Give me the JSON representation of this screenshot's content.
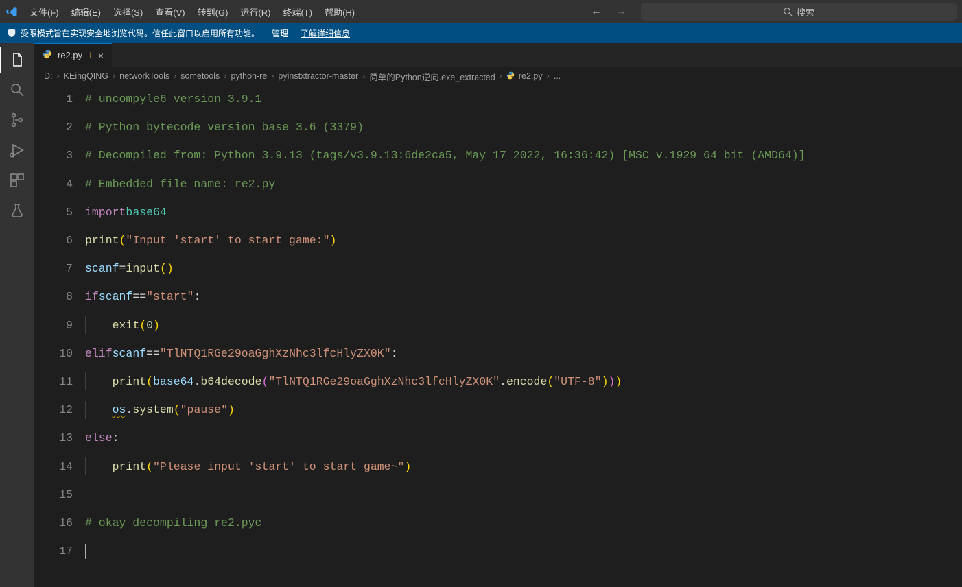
{
  "menu": {
    "items": [
      "文件(F)",
      "编辑(E)",
      "选择(S)",
      "查看(V)",
      "转到(G)",
      "运行(R)",
      "终端(T)",
      "帮助(H)"
    ]
  },
  "search": {
    "placeholder": "搜索"
  },
  "infobar": {
    "text": "受限模式旨在实现安全地浏览代码。信任此窗口以启用所有功能。",
    "manage": "管理",
    "learn": "了解详细信息"
  },
  "tab": {
    "filename": "re2.py",
    "problems": "1"
  },
  "breadcrumbs": [
    "D:",
    "KEingQING",
    "networkTools",
    "sometools",
    "python-re",
    "pyinstxtractor-master",
    "简单的Python逆向.exe_extracted",
    "re2.py",
    "..."
  ],
  "code": {
    "lines": [
      {
        "n": 1,
        "kind": "comment",
        "text": "# uncompyle6 version 3.9.1"
      },
      {
        "n": 2,
        "kind": "comment",
        "text": "# Python bytecode version base 3.6 (3379)"
      },
      {
        "n": 3,
        "kind": "comment",
        "text": "# Decompiled from: Python 3.9.13 (tags/v3.9.13:6de2ca5, May 17 2022, 16:36:42) [MSC v.1929 64 bit (AMD64)]"
      },
      {
        "n": 4,
        "kind": "comment",
        "text": "# Embedded file name: re2.py"
      },
      {
        "n": 5,
        "kind": "import",
        "kw": "import",
        "mod": "base64"
      },
      {
        "n": 6,
        "kind": "call",
        "indent": 0,
        "func": "print",
        "args_str": "\"Input 'start' to start game:\""
      },
      {
        "n": 7,
        "kind": "assign",
        "var": "scanf",
        "op": "=",
        "func": "input",
        "args_str": ""
      },
      {
        "n": 8,
        "kind": "if",
        "kw": "if",
        "cond_var": "scanf",
        "op": "==",
        "cond_str": "\"start\""
      },
      {
        "n": 9,
        "kind": "call",
        "indent": 1,
        "func": "exit",
        "args_num": "0"
      },
      {
        "n": 10,
        "kind": "elif",
        "kw": "elif",
        "cond_var": "scanf",
        "op": "==",
        "cond_str": "\"TlNTQ1RGe29oaGghXzNhc3lfcHlyZX0K\""
      },
      {
        "n": 11,
        "kind": "call2",
        "indent": 1,
        "func": "print",
        "obj": "base64",
        "method": "b64decode",
        "inner_str": "\"TlNTQ1RGe29oaGghXzNhc3lfcHlyZX0K\"",
        "chain_method": "encode",
        "chain_arg": "\"UTF-8\""
      },
      {
        "n": 12,
        "kind": "call3",
        "indent": 1,
        "obj": "os",
        "method": "system",
        "arg_str": "\"pause\"",
        "warn": "os"
      },
      {
        "n": 13,
        "kind": "else",
        "kw": "else"
      },
      {
        "n": 14,
        "kind": "call",
        "indent": 1,
        "func": "print",
        "args_str": "\"Please input 'start' to start game~\""
      },
      {
        "n": 15,
        "kind": "blank"
      },
      {
        "n": 16,
        "kind": "comment",
        "text": "# okay decompiling re2.pyc"
      },
      {
        "n": 17,
        "kind": "cursor"
      }
    ]
  }
}
